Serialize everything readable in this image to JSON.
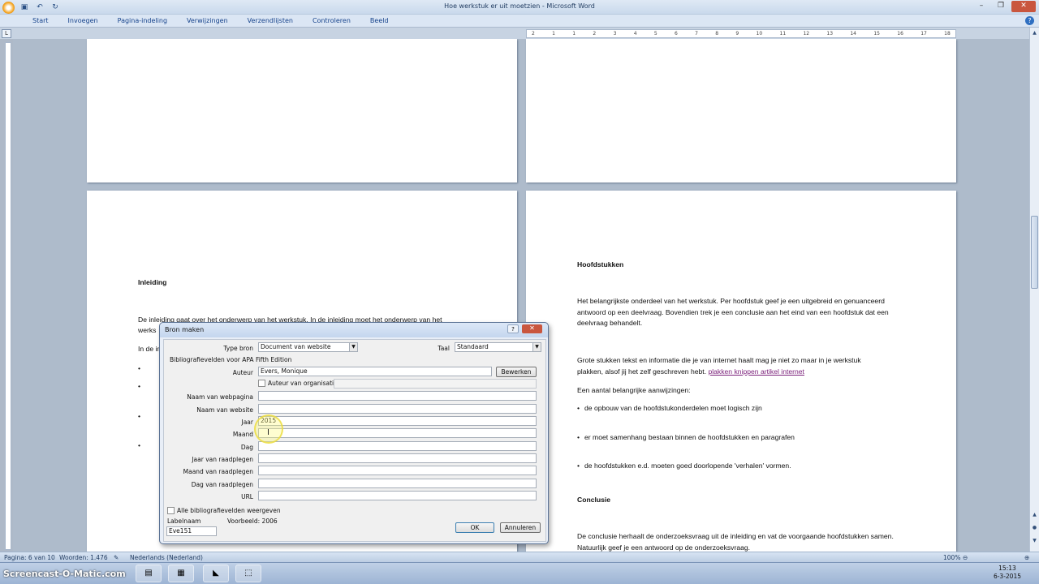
{
  "window": {
    "title": "Hoe werkstuk er uit moetzien - Microsoft Word",
    "qat": [
      "save-icon",
      "undo-icon",
      "redo-icon"
    ],
    "minimize": "–",
    "restore": "❐",
    "close": "✕"
  },
  "ribbon": {
    "tabs": [
      "Start",
      "Invoegen",
      "Pagina-indeling",
      "Verwijzingen",
      "Verzendlijsten",
      "Controleren",
      "Beeld"
    ],
    "help": "?"
  },
  "ruler": {
    "corner": "L",
    "marks": [
      "2",
      "1",
      "1",
      "2",
      "3",
      "4",
      "5",
      "6",
      "7",
      "8",
      "9",
      "10",
      "11",
      "12",
      "13",
      "14",
      "15",
      "16",
      "17",
      "18"
    ]
  },
  "document": {
    "page3": {
      "heading": "Inleiding",
      "p1": "De inleiding gaat over het onderwerp van het werkstuk. In de inleiding moet het onderwerp van het",
      "p2": "werks",
      "p3": "In de in"
    },
    "page4": {
      "heading1": "Hoofdstukken",
      "p1": "Het belangrijkste onderdeel van het werkstuk. Per hoofdstuk geef je een uitgebreid en genuanceerd antwoord op een deelvraag. Bovendien trek je een conclusie aan het eind van een hoofdstuk dat een deelvraag behandelt.",
      "p2_text": "Grote stukken tekst en informatie die je van internet haalt mag je niet zo maar in je werkstuk plakken, alsof jij het zelf geschreven hebt.",
      "p2_link": "plakken knippen artikel internet",
      "p3": "Een aantal belangrijke aanwijzingen:",
      "bullets": [
        "de opbouw van de hoofdstukonderdelen moet logisch zijn",
        "er moet samenhang bestaan binnen de hoofdstukken en paragrafen",
        "de hoofdstukken e.d. moeten goed doorlopende 'verhalen' vormen."
      ],
      "heading2": "Conclusie",
      "p4": "De conclusie herhaalt de onderzoeksvraag uit de inleiding en vat de voorgaande hoofdstukken samen. Natuurlijk geef je een antwoord op de onderzoeksvraag."
    }
  },
  "dialog": {
    "title": "Bron maken",
    "help": "?",
    "close": "✕",
    "type_label": "Type bron",
    "type_value": "Document van website",
    "taal_label": "Taal",
    "taal_value": "Standaard",
    "section_label": "Bibliografievelden voor APA Fifth Edition",
    "auteur_label": "Auteur",
    "auteur_value": "Evers, Monique",
    "bewerken": "Bewerken",
    "org_checkbox": "Auteur van organisatie",
    "fields": [
      {
        "label": "Naam van webpagina",
        "value": ""
      },
      {
        "label": "Naam van website",
        "value": ""
      },
      {
        "label": "Jaar",
        "value": "2015"
      },
      {
        "label": "Maand",
        "value": ""
      },
      {
        "label": "Dag",
        "value": ""
      },
      {
        "label": "Jaar van raadplegen",
        "value": ""
      },
      {
        "label": "Maand van raadplegen",
        "value": ""
      },
      {
        "label": "Dag van raadplegen",
        "value": ""
      },
      {
        "label": "URL",
        "value": ""
      }
    ],
    "show_all": "Alle bibliografievelden weergeven",
    "labelnaam_label": "Labelnaam",
    "voorbeeld": "Voorbeeld: 2006",
    "labelnaam_value": "Eve151",
    "ok": "OK",
    "cancel": "Annuleren"
  },
  "statusbar": {
    "page": "Pagina: 6 van 10",
    "words": "Woorden: 1.476",
    "language": "Nederlands (Nederland)",
    "zoom": "100%"
  },
  "taskbar": {
    "watermark": "Screencast-O-Matic.com",
    "time": "15:13",
    "date": "6-3-2015"
  },
  "colors": {
    "link": "#7a1f7a",
    "close_button": "#c9563e",
    "ribbon_text": "#15428b"
  }
}
